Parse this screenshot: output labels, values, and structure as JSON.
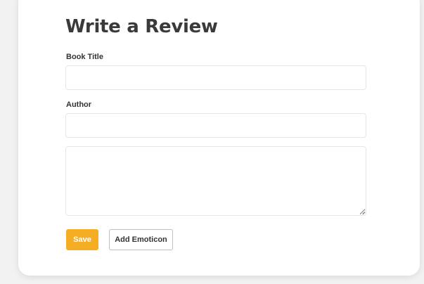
{
  "form": {
    "title": "Write a Review",
    "book_title": {
      "label": "Book Title",
      "value": "",
      "placeholder": ""
    },
    "author": {
      "label": "Author",
      "value": "",
      "placeholder": ""
    },
    "review": {
      "value": "",
      "placeholder": ""
    }
  },
  "actions": {
    "save_label": "Save",
    "add_emoticon_label": "Add Emoticon"
  },
  "colors": {
    "accent": "#f5ad24",
    "page_background": "#f2f2f2",
    "card_background": "#ffffff"
  }
}
